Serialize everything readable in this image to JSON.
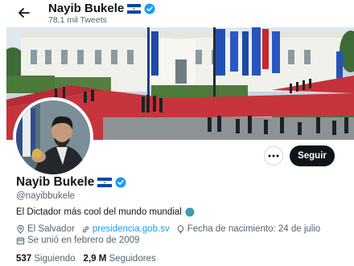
{
  "header": {
    "back_icon": "arrow-left-icon",
    "name": "Nayib Bukele",
    "tweet_count": "78,1 mil Tweets"
  },
  "profile": {
    "name": "Nayib Bukele",
    "handle": "@nayibbukele",
    "bio": "El Dictador más cool del mundo mundial",
    "location": "El Salvador",
    "website": "presidencia.gob.sv",
    "birthday": "Fecha de nacimiento: 24 de julio",
    "joined": "Se unió en febrero de 2009",
    "following_count": "537",
    "following_label": "Siguiendo",
    "followers_count": "2,9 M",
    "followers_label": "Seguidores"
  },
  "actions": {
    "more_icon": "more-horizontal-icon",
    "follow_label": "Seguir"
  },
  "colors": {
    "accent": "#1d9bf0",
    "text": "#0f1419",
    "muted": "#536471"
  }
}
